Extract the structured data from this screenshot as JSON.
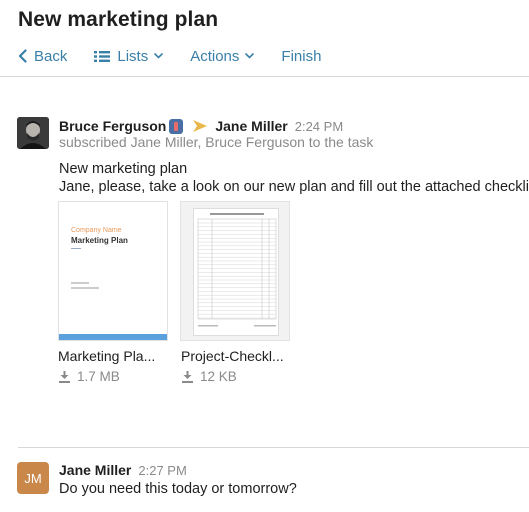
{
  "page": {
    "title": "New marketing plan"
  },
  "toolbar": {
    "back_label": "Back",
    "lists_label": "Lists",
    "actions_label": "Actions",
    "finish_label": "Finish"
  },
  "messages": [
    {
      "author": "Bruce Ferguson",
      "recipient": "Jane Miller",
      "time": "2:24 PM",
      "subtext": "subscribed Jane Miller, Bruce Ferguson to the task",
      "lines": [
        "New marketing plan",
        "Jane, please, take a look on our new plan and fill out the attached checklist."
      ],
      "attachments": [
        {
          "name": "Marketing Pla...",
          "size": "1.7 MB",
          "preview": {
            "company": "Company Name",
            "title": "Marketing Plan"
          }
        },
        {
          "name": "Project-Checkl...",
          "size": "12 KB"
        }
      ]
    },
    {
      "author": "Jane Miller",
      "initials": "JM",
      "time": "2:27 PM",
      "text": "Do you need this today or tomorrow?"
    }
  ],
  "colors": {
    "accent": "#3a7fa8",
    "avatar_jm": "#c9874a",
    "flag": "#e8b84a",
    "thumb_bar": "#5aa0dc"
  },
  "icons": [
    "chevron-left-icon",
    "list-icon",
    "chevron-down-icon",
    "flag-arrow-icon",
    "download-icon",
    "user-badge-icon"
  ]
}
